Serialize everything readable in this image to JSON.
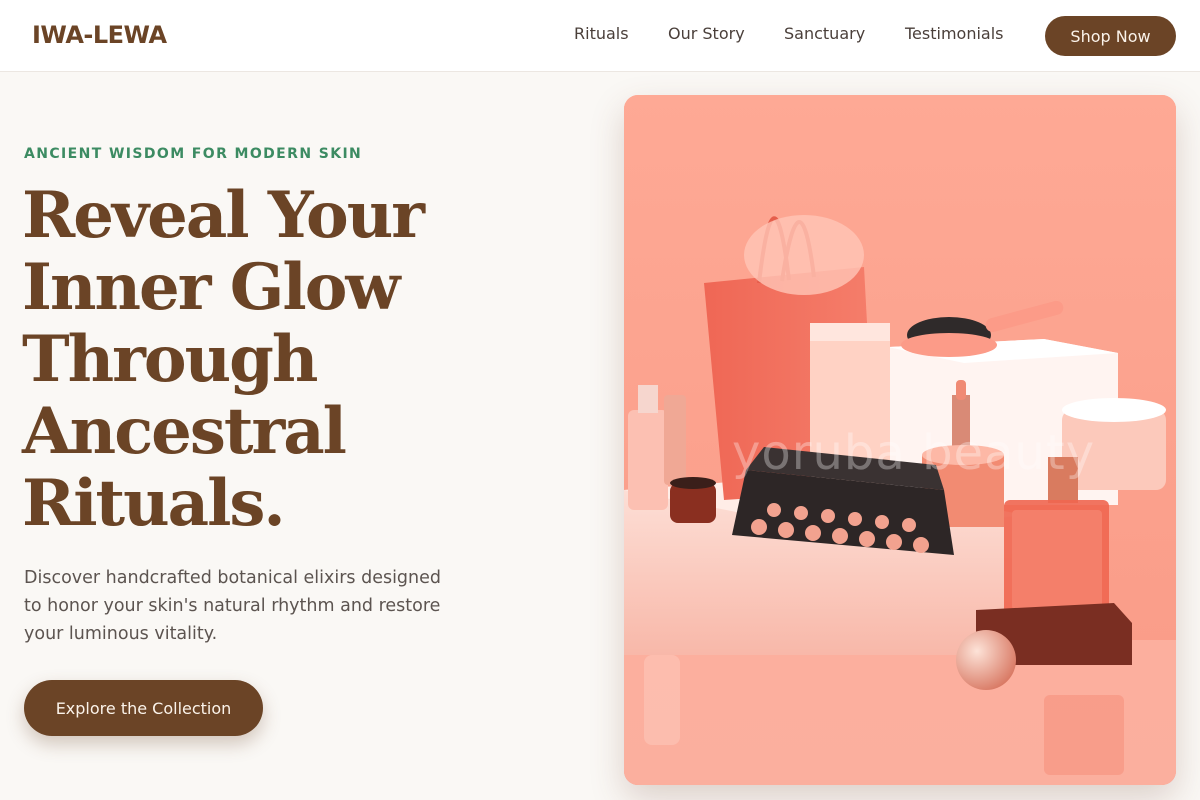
{
  "brand": {
    "logo": "IWA-LEWA"
  },
  "nav": {
    "links": [
      "Rituals",
      "Our Story",
      "Sanctuary",
      "Testimonials"
    ],
    "shop_button": "Shop Now"
  },
  "hero": {
    "eyebrow": "ANCIENT WISDOM FOR MODERN SKIN",
    "headline_lines": [
      "Reveal Your",
      "Inner Glow",
      "Through",
      "Ancestral",
      "Rituals."
    ],
    "description": "Discover handcrafted botanical elixirs designed to honor your skin's natural rhythm and restore your luminous vitality.",
    "cta_label": "Explore the Collection"
  },
  "image": {
    "watermark": "yoruba beauty"
  },
  "colors": {
    "brand_brown": "#6b4426",
    "accent_green": "#3c8b62",
    "page_background": "#faf8f5",
    "hero_background": "#fda896"
  }
}
